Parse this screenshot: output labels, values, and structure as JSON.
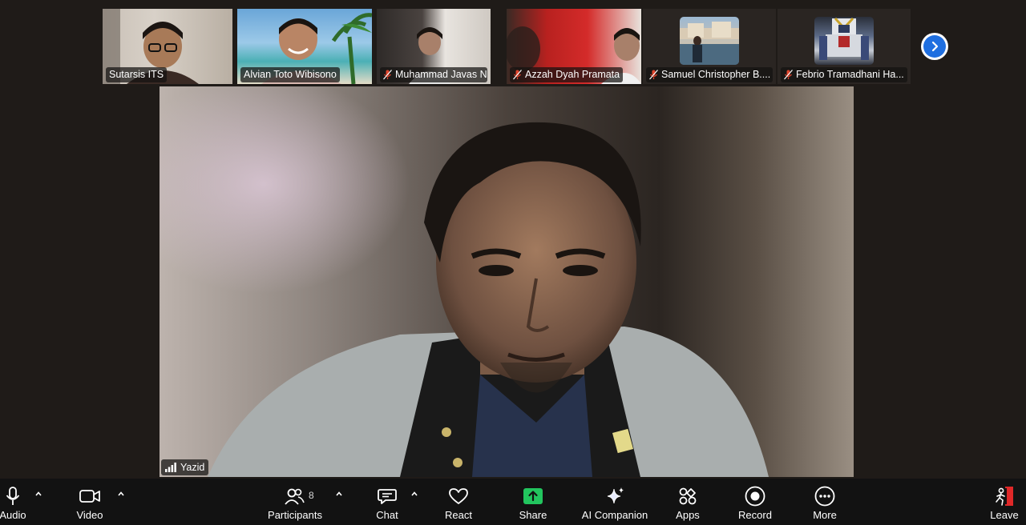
{
  "participants_strip": [
    {
      "name": "Sutarsis ITS",
      "muted": false
    },
    {
      "name": "Alvian Toto Wibisono",
      "muted": false
    },
    {
      "name": "Muhammad Javas Nau...",
      "muted": true
    },
    {
      "name": "Azzah Dyah Pramata",
      "muted": true
    },
    {
      "name": "Samuel Christopher B....",
      "muted": true
    },
    {
      "name": "Febrio Tramadhani Ha...",
      "muted": true
    }
  ],
  "next_page_icon": "chevron-right-icon",
  "main_speaker": {
    "name": "Yazid",
    "signal_icon": "signal-bars-icon"
  },
  "toolbar": {
    "audio": "Audio",
    "video": "Video",
    "participants": "Participants",
    "participants_count": "8",
    "chat": "Chat",
    "react": "React",
    "share": "Share",
    "ai_companion": "AI Companion",
    "apps": "Apps",
    "record": "Record",
    "more": "More",
    "leave": "Leave"
  },
  "colors": {
    "background": "#1f1b18",
    "toolbar": "#121212",
    "share_green": "#22c55e",
    "leave_red": "#e02828",
    "accent_blue": "#1f6fe0",
    "mute_red": "#e0442c"
  }
}
